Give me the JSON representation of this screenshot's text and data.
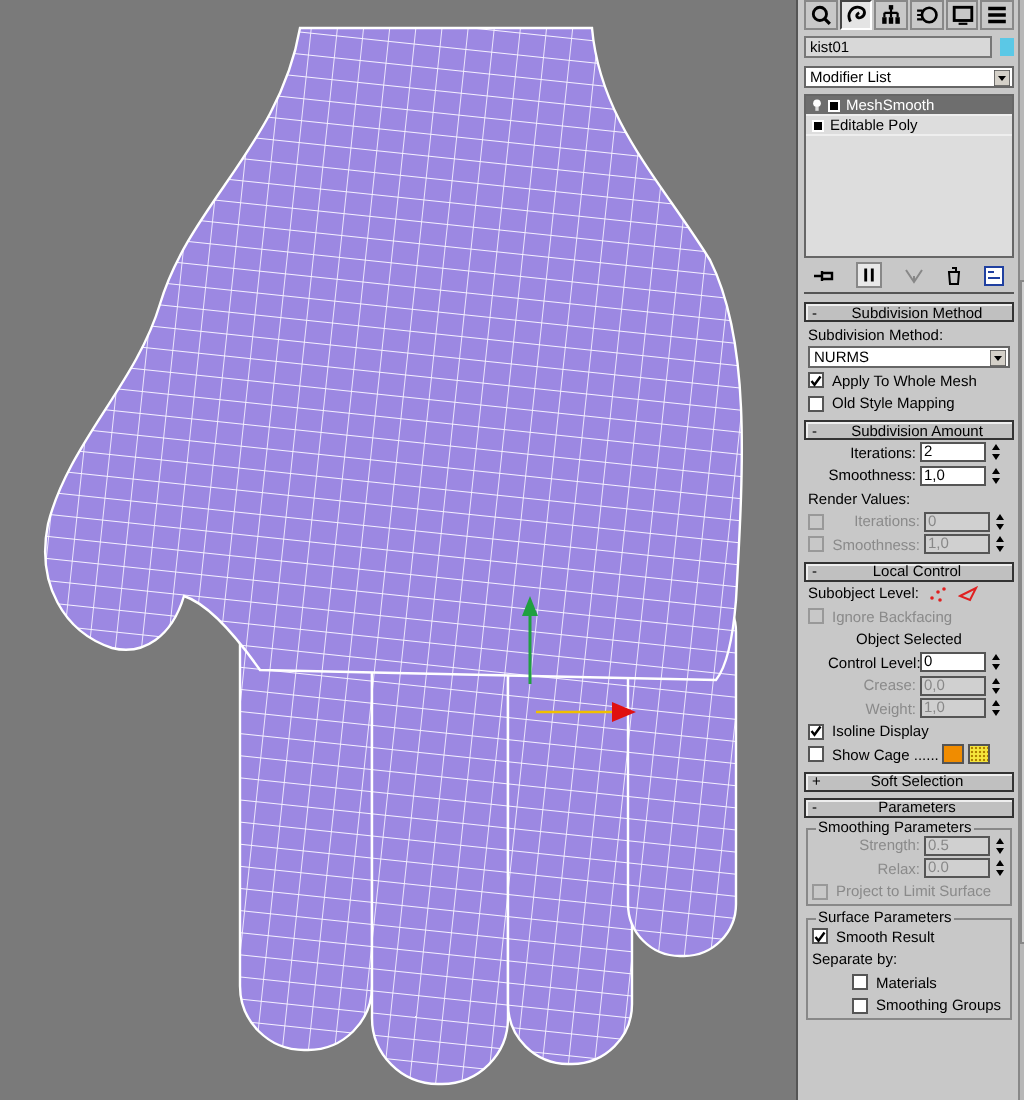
{
  "tabs": [
    {
      "selected": false
    },
    {
      "selected": true
    },
    {
      "selected": false
    },
    {
      "selected": false
    },
    {
      "selected": false
    },
    {
      "selected": false
    }
  ],
  "object_name": "kist01",
  "modifier_list": "Modifier List",
  "stack": [
    {
      "label": "MeshSmooth",
      "selected": true
    },
    {
      "label": "Editable Poly",
      "selected": false
    }
  ],
  "rollouts": [
    {
      "sign": "-",
      "title": "Subdivision Method",
      "controls": [
        {
          "kind": "label",
          "text": "Subdivision Method:"
        },
        {
          "kind": "dropdown",
          "value": "NURMS"
        },
        {
          "kind": "checkbox",
          "label": "Apply To Whole Mesh",
          "checked": true,
          "disabled": false
        },
        {
          "kind": "checkbox",
          "label": "Old Style Mapping",
          "checked": false,
          "disabled": false
        }
      ]
    },
    {
      "sign": "-",
      "title": "Subdivision Amount",
      "controls": [
        {
          "kind": "spinner",
          "label": "Iterations:",
          "value": "2",
          "disabled": false
        },
        {
          "kind": "spinner",
          "label": "Smoothness:",
          "value": "1,0",
          "disabled": false
        },
        {
          "kind": "label",
          "text": "Render Values:"
        },
        {
          "kind": "check_spinner",
          "label": "Iterations:",
          "value": "0",
          "checked": false,
          "disabled": true
        },
        {
          "kind": "check_spinner",
          "label": "Smoothness:",
          "value": "1,0",
          "checked": false,
          "disabled": true
        }
      ]
    },
    {
      "sign": "-",
      "title": "Local Control",
      "controls": [
        {
          "kind": "subobject",
          "text": "Subobject Level:"
        },
        {
          "kind": "checkbox",
          "label": "Ignore Backfacing",
          "checked": false,
          "disabled": true
        },
        {
          "kind": "centered",
          "text": "Object Selected"
        },
        {
          "kind": "spinner",
          "label": "Control Level:",
          "value": "0",
          "disabled": false
        },
        {
          "kind": "spinner",
          "label": "Crease:",
          "value": "0,0",
          "disabled": true
        },
        {
          "kind": "spinner",
          "label": "Weight:",
          "value": "1,0",
          "disabled": true
        },
        {
          "kind": "checkbox",
          "label": "Isoline Display",
          "checked": true,
          "disabled": false
        },
        {
          "kind": "cage",
          "label": "Show Cage ......",
          "checked": false,
          "swatches": [
            {
              "color": "#f08c00"
            },
            {
              "color": "#f5e63c"
            }
          ]
        }
      ]
    },
    {
      "sign": "+",
      "title": "Soft Selection"
    },
    {
      "sign": "-",
      "title": "Parameters",
      "controls": [
        {
          "kind": "group",
          "title": "Smoothing Parameters",
          "controls": [
            {
              "kind": "spinner",
              "label": "Strength:",
              "value": "0.5",
              "disabled": true
            },
            {
              "kind": "spinner",
              "label": "Relax:",
              "value": "0.0",
              "disabled": true
            },
            {
              "kind": "checkbox",
              "label": "Project to Limit Surface",
              "checked": false,
              "disabled": true
            }
          ]
        },
        {
          "kind": "group",
          "title": "Surface Parameters",
          "controls": [
            {
              "kind": "checkbox",
              "label": "Smooth Result",
              "checked": true,
              "disabled": false
            },
            {
              "kind": "label",
              "text": "Separate by:"
            },
            {
              "kind": "subcheckbox",
              "label": "Materials",
              "checked": false,
              "disabled": false
            },
            {
              "kind": "subcheckbox",
              "label": "Smoothing Groups",
              "checked": false,
              "disabled": false
            }
          ]
        }
      ]
    }
  ]
}
